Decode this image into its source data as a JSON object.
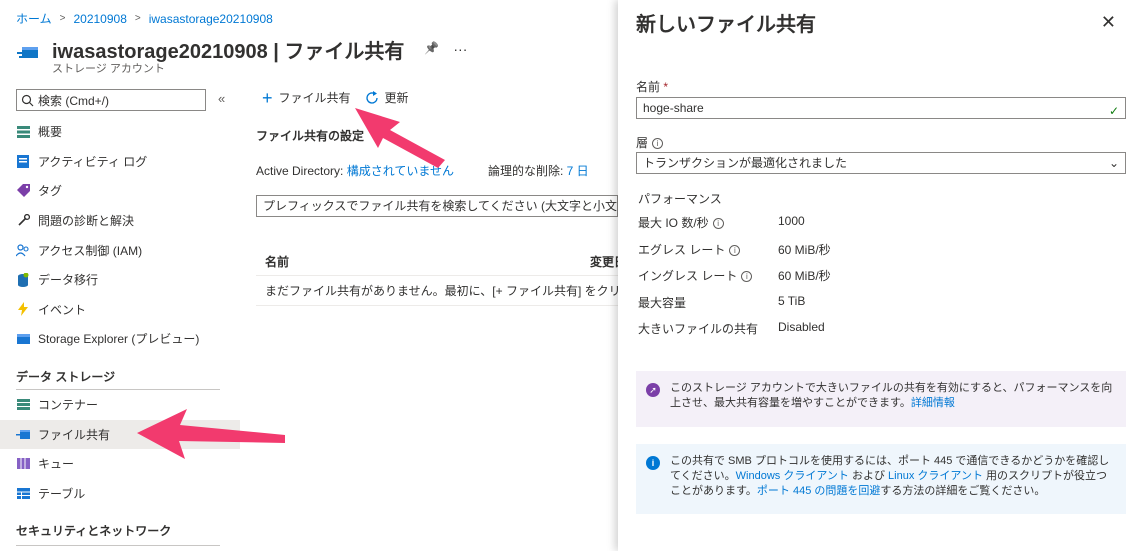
{
  "breadcrumb": {
    "home": "ホーム",
    "item1": "20210908",
    "item2": "iwasastorage20210908",
    "sep": ">"
  },
  "header": {
    "title": "iwasastorage20210908 | ファイル共有",
    "subtitle": "ストレージ アカウント",
    "pin": "📌",
    "more": "···"
  },
  "sidebar": {
    "search_placeholder": "検索 (Cmd+/)",
    "collapse": "«",
    "items": [
      {
        "label": "概要",
        "icon": "overview-icon"
      },
      {
        "label": "アクティビティ ログ",
        "icon": "activity-log-icon"
      },
      {
        "label": "タグ",
        "icon": "tag-icon"
      },
      {
        "label": "問題の診断と解決",
        "icon": "wrench-icon"
      },
      {
        "label": "アクセス制御 (IAM)",
        "icon": "people-icon"
      },
      {
        "label": "データ移行",
        "icon": "data-migration-icon"
      },
      {
        "label": "イベント",
        "icon": "lightning-icon"
      },
      {
        "label": "Storage Explorer (プレビュー)",
        "icon": "storage-explorer-icon"
      }
    ],
    "section_data_storage": "データ ストレージ",
    "data_items": [
      {
        "label": "コンテナー",
        "icon": "container-icon"
      },
      {
        "label": "ファイル共有",
        "icon": "file-share-icon"
      },
      {
        "label": "キュー",
        "icon": "queue-icon"
      },
      {
        "label": "テーブル",
        "icon": "table-icon"
      }
    ],
    "section_security": "セキュリティとネットワーク"
  },
  "toolbar": {
    "add_label": "ファイル共有",
    "refresh_label": "更新"
  },
  "main": {
    "settings_title": "ファイル共有の設定",
    "ad_label": "Active Directory:",
    "ad_value": "構成されていません",
    "softdelete_label": "論理的な削除:",
    "softdelete_value": "7 日",
    "prefix_placeholder": "プレフィックスでファイル共有を検索してください (大文字と小文字",
    "col_name": "名前",
    "col_modified": "変更日",
    "empty_text": "まだファイル共有がありません。最初に、[+ ファイル共有] をクリック"
  },
  "panel": {
    "title": "新しいファイル共有",
    "close": "✕",
    "name_label": "名前",
    "name_required": "*",
    "name_value": "hoge-share",
    "tier_label": "層",
    "tier_value": "トランザクションが最適化されました",
    "perf_title": "パフォーマンス",
    "perf_rows": [
      {
        "label": "最大 IO 数/秒",
        "value": "1000",
        "info": true
      },
      {
        "label": "エグレス レート",
        "value": "60 MiB/秒",
        "info": true
      },
      {
        "label": "イングレス レート",
        "value": "60 MiB/秒",
        "info": true
      },
      {
        "label": "最大容量",
        "value": "5 TiB",
        "info": false
      },
      {
        "label": "大きいファイルの共有",
        "value": "Disabled",
        "info": false
      }
    ],
    "notice_large": "このストレージ アカウントで大きいファイルの共有を有効にすると、パフォーマンスを向上させ、最大共有容量を増やすことができます。",
    "notice_large_link": "詳細情報",
    "notice_smb_1": "この共有で SMB プロトコルを使用するには、ポート 445 で通信できるかどうかを確認してください。",
    "notice_smb_link1": "Windows クライアント",
    "notice_smb_and": " および ",
    "notice_smb_link2": "Linux クライアント",
    "notice_smb_2": " 用のスクリプトが役立つことがあります。",
    "notice_smb_link3": "ポート 445 の問題を回避",
    "notice_smb_3": "する方法の詳細をご覧ください。"
  },
  "colors": {
    "accent": "#0078d4",
    "arrow": "#f23a6e",
    "purple_notice": "#f4f0f8",
    "blue_notice": "#eff6fc"
  }
}
